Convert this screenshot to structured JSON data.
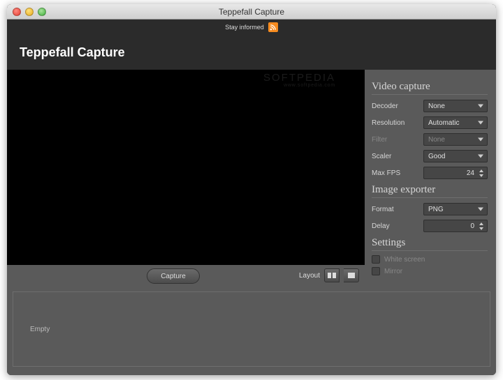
{
  "window": {
    "title": "Teppefall Capture"
  },
  "topstrip": {
    "label": "Stay informed"
  },
  "header": {
    "title": "Teppefall Capture"
  },
  "watermark": {
    "text": "SOFTPEDIA",
    "sub": "www.softpedia.com"
  },
  "toolbar": {
    "capture": "Capture",
    "layout_label": "Layout"
  },
  "bottom": {
    "empty": "Empty"
  },
  "side": {
    "video_capture": {
      "heading": "Video capture",
      "decoder_label": "Decoder",
      "decoder_value": "None",
      "resolution_label": "Resolution",
      "resolution_value": "Automatic",
      "filter_label": "Filter",
      "filter_value": "None",
      "scaler_label": "Scaler",
      "scaler_value": "Good",
      "maxfps_label": "Max FPS",
      "maxfps_value": "24"
    },
    "image_exporter": {
      "heading": "Image exporter",
      "format_label": "Format",
      "format_value": "PNG",
      "delay_label": "Delay",
      "delay_value": "0"
    },
    "settings": {
      "heading": "Settings",
      "white_screen": "White screen",
      "mirror": "Mirror"
    }
  }
}
